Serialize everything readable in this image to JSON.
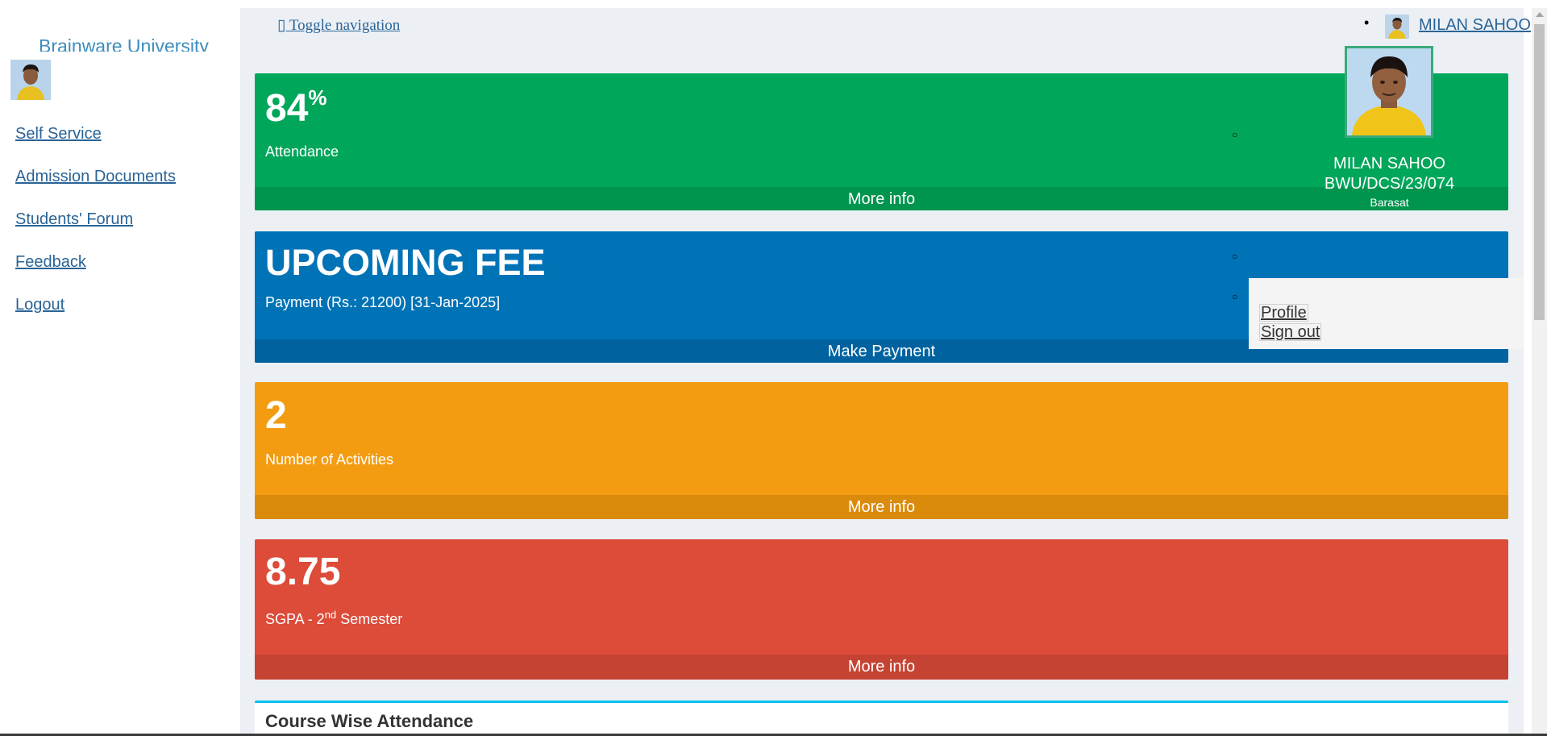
{
  "sidebar": {
    "brand": "Brainware University",
    "items": [
      {
        "label": "Self Service"
      },
      {
        "label": "Admission Documents"
      },
      {
        "label": "Students' Forum"
      },
      {
        "label": "Feedback"
      },
      {
        "label": "Logout"
      }
    ]
  },
  "header": {
    "toggle_label": "▯ Toggle navigation",
    "user_name": "MILAN SAHOO"
  },
  "user_panel": {
    "name": "MILAN SAHOO",
    "id": "BWU/DCS/23/074",
    "campus": "Barasat",
    "profile_label": "Profile",
    "signout_label": "Sign out"
  },
  "boxes": {
    "attendance": {
      "value": "84",
      "unit": "%",
      "label": "Attendance",
      "footer": "More info",
      "color": "#00a65a"
    },
    "fee": {
      "value": "UPCOMING FEE",
      "label": "Payment (Rs.: 21200) [31-Jan-2025]",
      "footer": "Make Payment",
      "color": "#0073b7"
    },
    "activities": {
      "value": "2",
      "label": "Number of Activities",
      "footer": "More info",
      "color": "#f39c12"
    },
    "sgpa": {
      "value": "8.75",
      "label_pre": "SGPA - 2",
      "label_sup": "nd",
      "label_post": " Semester",
      "footer": "More info",
      "color": "#dd4b39"
    }
  },
  "course_card": {
    "title": "Course Wise Attendance"
  }
}
